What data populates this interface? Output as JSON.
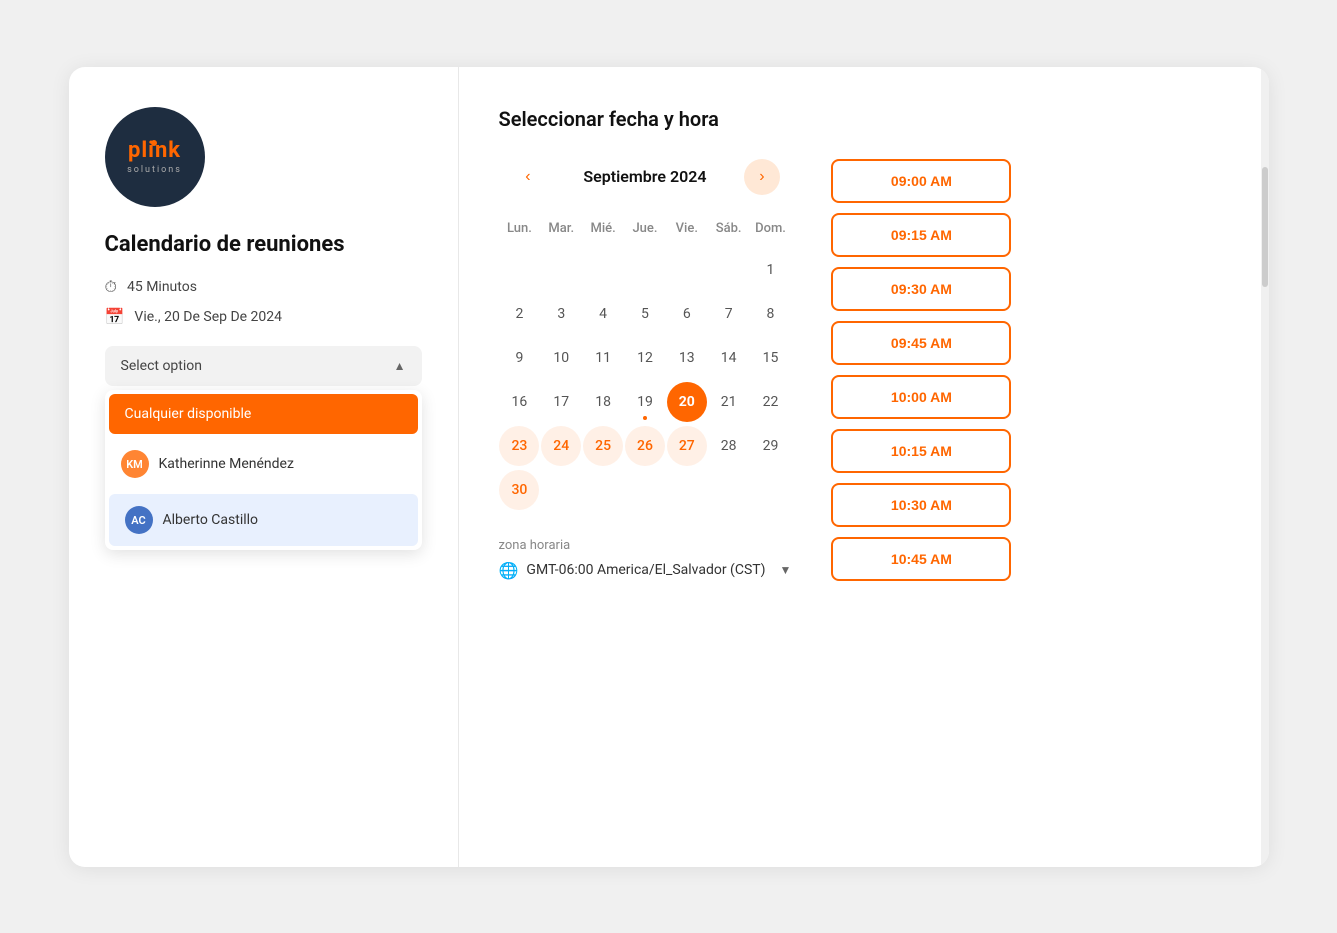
{
  "left": {
    "title": "Calendario de reuniones",
    "duration": "45 Minutos",
    "date": "Vie., 20 De Sep De 2024",
    "select_placeholder": "Select option",
    "dropdown": {
      "items": [
        {
          "id": "any",
          "label": "Cualquier disponible",
          "type": "any"
        },
        {
          "id": "katherinne",
          "label": "Katherinne Menéndez",
          "type": "person",
          "initials": "KM",
          "color": "orange"
        },
        {
          "id": "alberto",
          "label": "Alberto Castillo",
          "type": "person",
          "initials": "AC",
          "color": "blue"
        }
      ]
    }
  },
  "right": {
    "section_title": "Seleccionar fecha y hora",
    "month_label": "Septiembre 2024",
    "nav_prev": "‹",
    "nav_next": "›",
    "weekdays": [
      "Lun.",
      "Mar.",
      "Mié.",
      "Jue.",
      "Vie.",
      "Sáb.",
      "Dom."
    ],
    "calendar_rows": [
      [
        null,
        null,
        null,
        null,
        null,
        null,
        "1"
      ],
      [
        "2",
        "3",
        "4",
        "5",
        "6",
        "7",
        "8"
      ],
      [
        "9",
        "10",
        "11",
        "12",
        "13",
        "14",
        "15"
      ],
      [
        "16",
        "17",
        "18",
        "19",
        "20",
        "21",
        "22"
      ],
      [
        "23",
        "24",
        "25",
        "26",
        "27",
        "28",
        "29"
      ],
      [
        "30",
        null,
        null,
        null,
        null,
        null,
        null
      ]
    ],
    "active_dates": [
      "23",
      "24",
      "25",
      "26",
      "27",
      "30"
    ],
    "selected_date": "20",
    "dot_date": "19",
    "time_slots": [
      "09:00 AM",
      "09:15 AM",
      "09:30 AM",
      "09:45 AM",
      "10:00 AM",
      "10:15 AM",
      "10:30 AM",
      "10:45 AM"
    ],
    "timezone": {
      "label": "zona horaria",
      "value": "GMT-06:00 America/El_Salvador (CST)"
    }
  }
}
